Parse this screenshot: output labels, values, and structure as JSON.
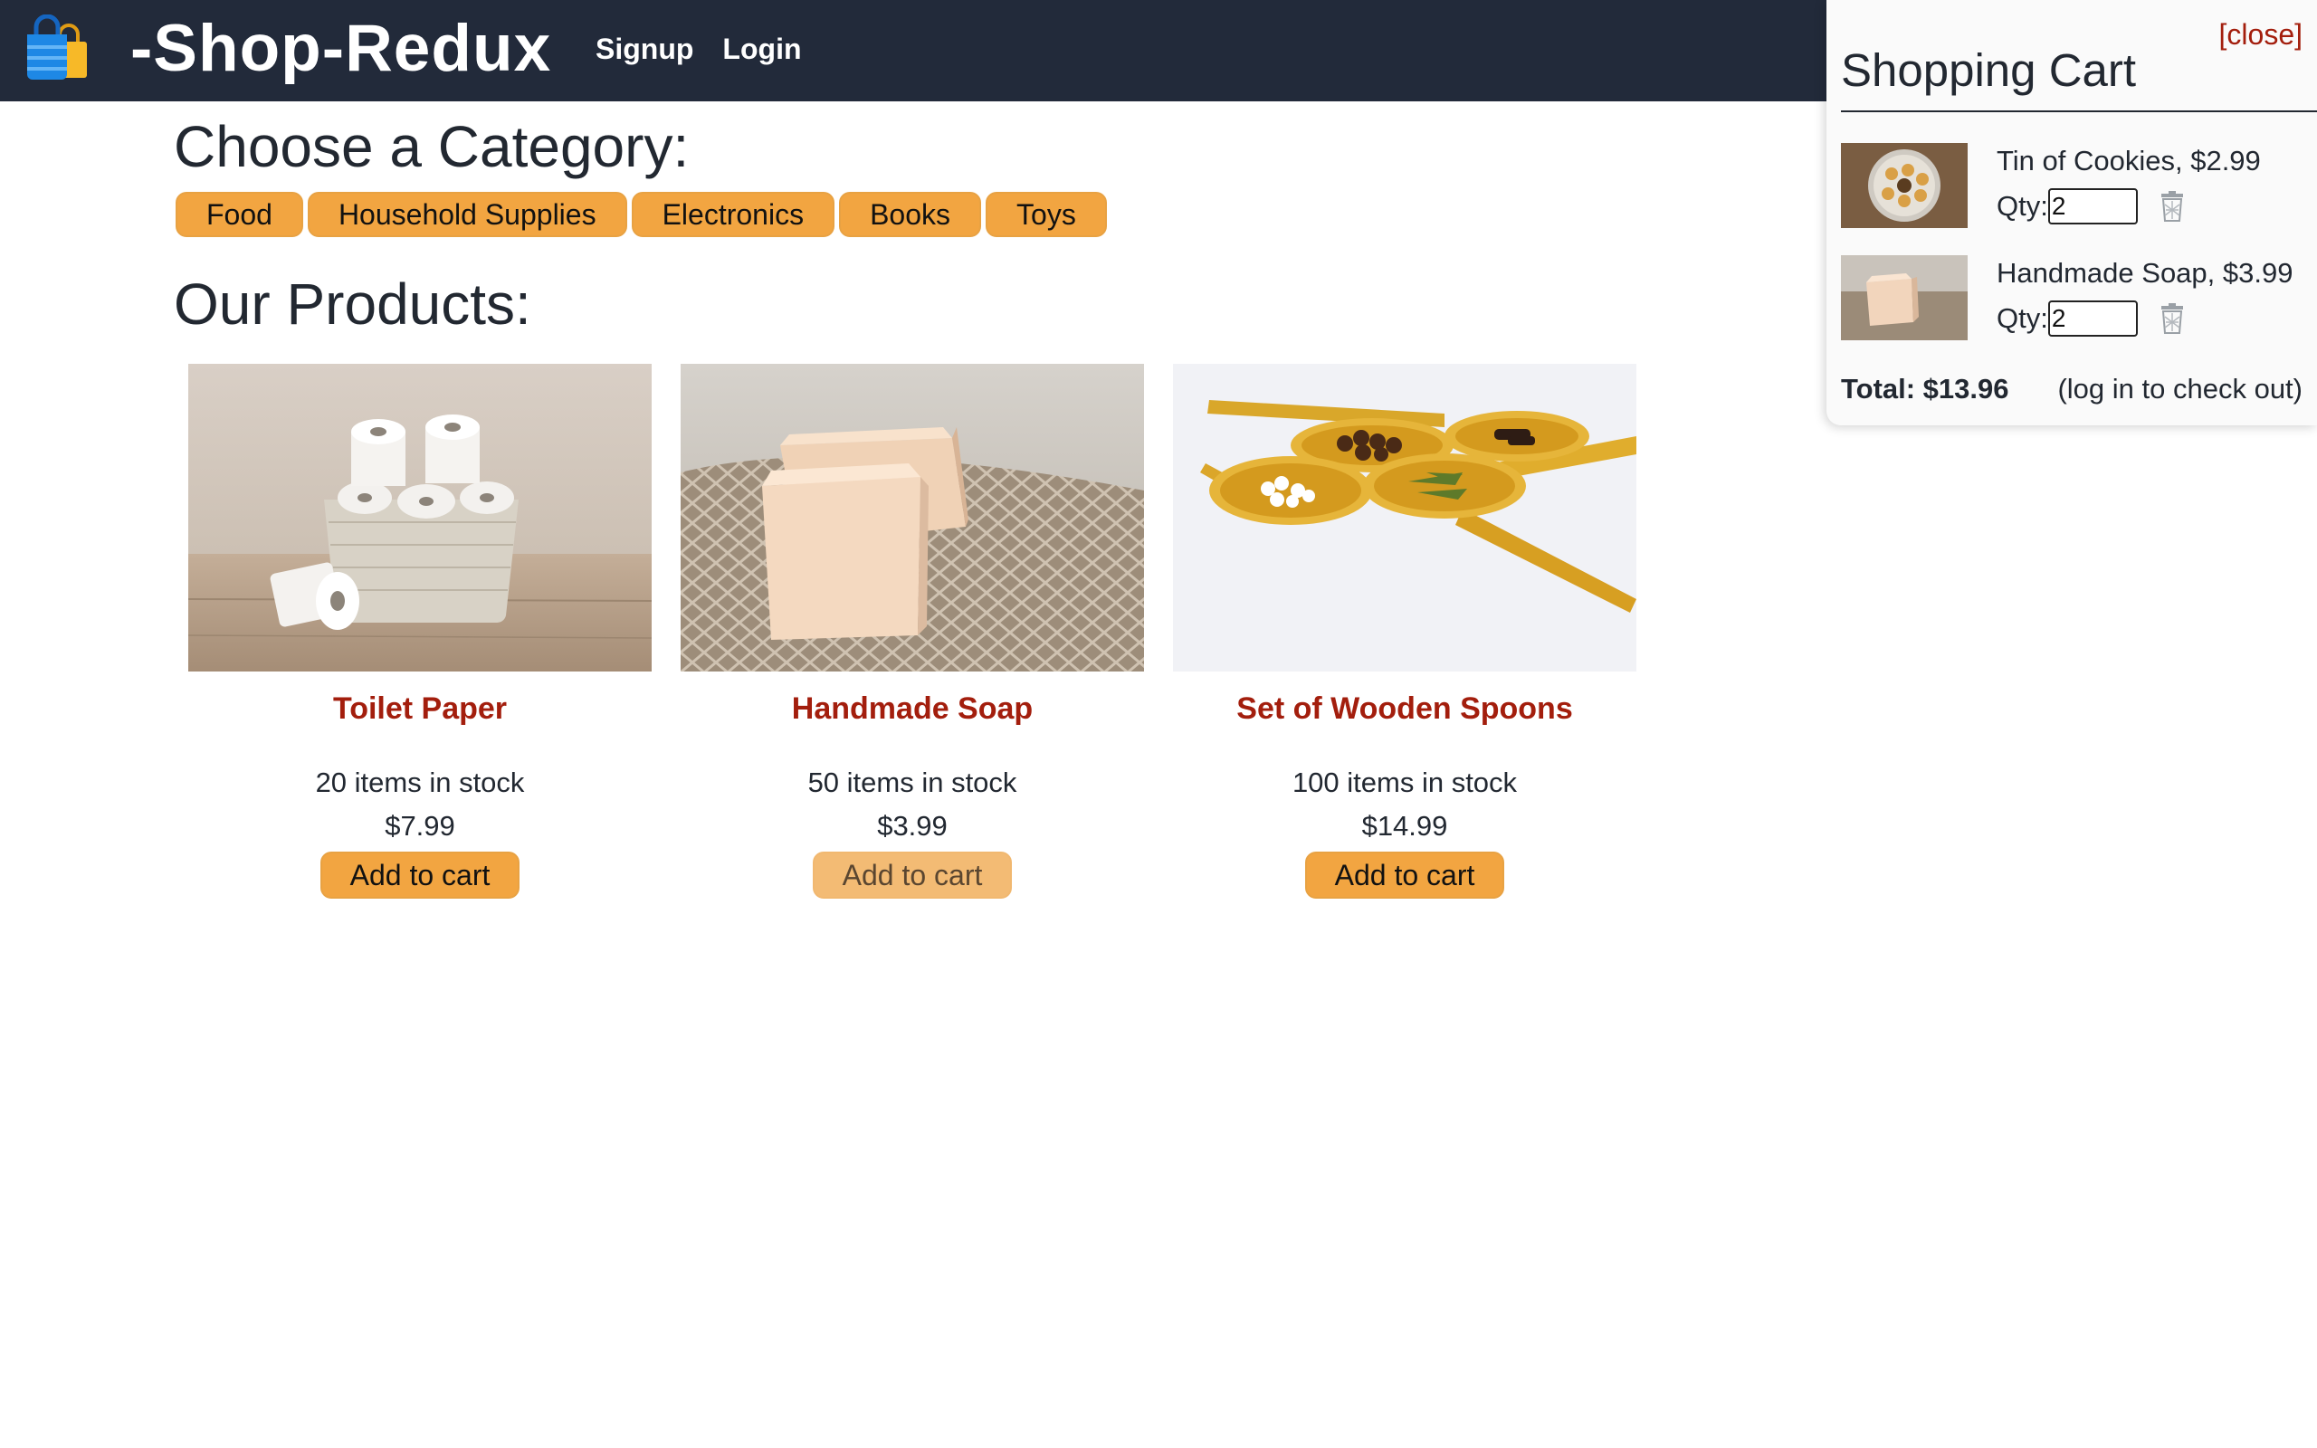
{
  "header": {
    "brand": "-Shop-Redux",
    "brand_icon": "shopping-bags-icon",
    "nav": [
      "Signup",
      "Login"
    ]
  },
  "categories": {
    "title": "Choose a Category:",
    "items": [
      "Food",
      "Household Supplies",
      "Electronics",
      "Books",
      "Toys"
    ]
  },
  "products": {
    "title": "Our Products:",
    "add_label": "Add to cart",
    "items": [
      {
        "name": "Toilet Paper",
        "stock": "20 items in stock",
        "price": "$7.99",
        "image": "toilet-paper-basket-photo"
      },
      {
        "name": "Handmade Soap",
        "stock": "50 items in stock",
        "price": "$3.99",
        "image": "soap-bars-photo"
      },
      {
        "name": "Set of Wooden Spoons",
        "stock": "100 items in stock",
        "price": "$14.99",
        "image": "wooden-spoons-photo"
      }
    ]
  },
  "cart": {
    "close": "[close]",
    "title": "Shopping Cart",
    "qty_label": "Qty:",
    "items": [
      {
        "label": "Tin of Cookies, $2.99",
        "qty": "2",
        "image": "cookie-tin-photo"
      },
      {
        "label": "Handmade Soap, $3.99",
        "qty": "2",
        "image": "soap-bar-photo"
      }
    ],
    "total": "Total: $13.96",
    "checkout_note": "(log in to check out)"
  },
  "colors": {
    "navbar": "#222a3a",
    "accent_button": "#f2a541",
    "product_name": "#a31e0d"
  }
}
